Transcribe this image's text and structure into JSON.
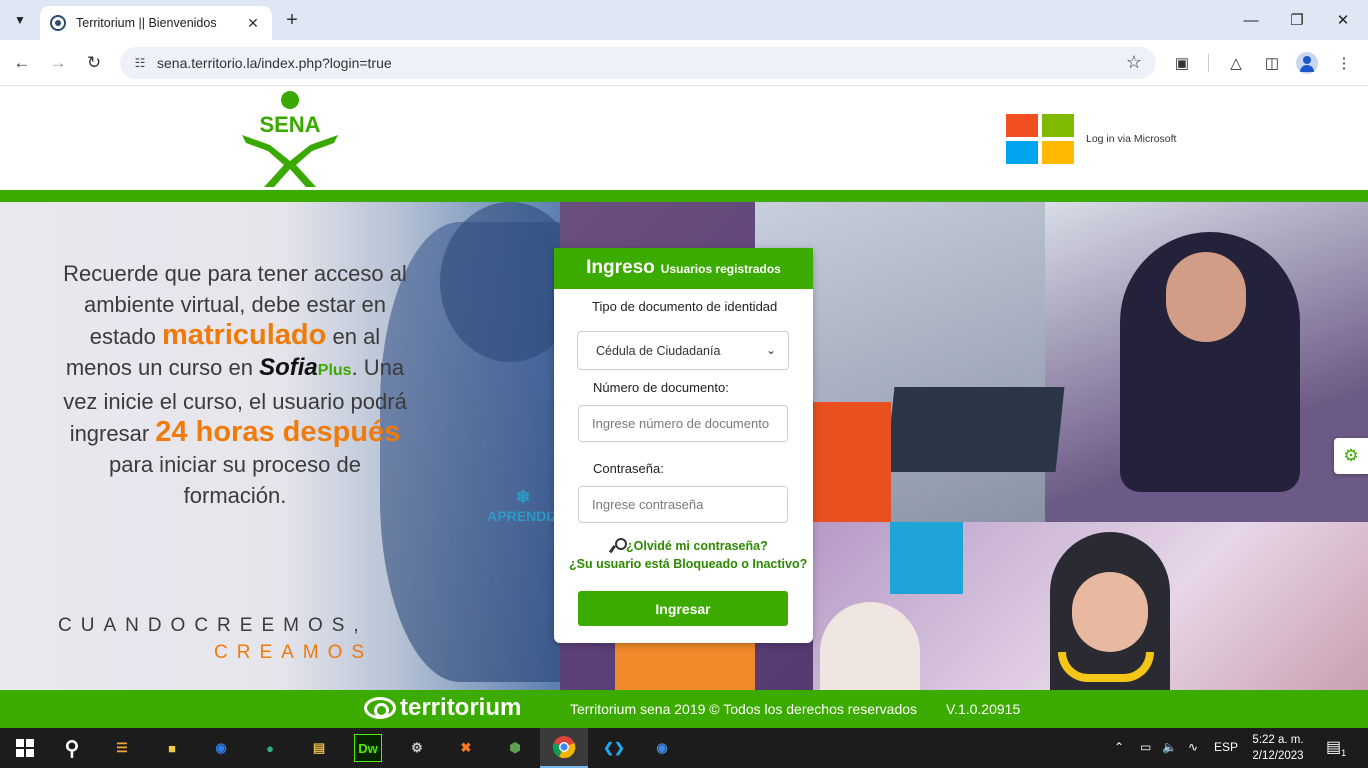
{
  "browser": {
    "tab_title": "Territorium || Bienvenidos",
    "url": "sena.territorio.la/index.php?login=true"
  },
  "header": {
    "logo_text": "SENA",
    "microsoft_login": "Log in via Microsoft",
    "ms_colors": [
      "#f25022",
      "#7fba00",
      "#00a4ef",
      "#ffb900"
    ]
  },
  "promo": {
    "line1": "Recuerde que para tener acceso al ambiente virtual, debe estar en estado",
    "highlight1": "matriculado",
    "line2": "en al menos un curso en",
    "sofia": "Sofia",
    "plus": "Plus",
    "line3": ". Una vez inicie el curso, el usuario podrá ingresar",
    "highlight2": "24 horas después",
    "line4": "para iniciar su proceso de formación.",
    "slogan_top": "CUANDOCREEMOS,",
    "slogan_bottom": "CREAMOS",
    "aprendiz": "APRENDIZ"
  },
  "login": {
    "title": "Ingreso",
    "subtitle": "Usuarios registrados",
    "doc_type_label": "Tipo de documento de identidad",
    "doc_type_value": "Cédula de Ciudadanía",
    "doc_number_label": "Número de documento:",
    "doc_number_placeholder": "Ingrese número de documento",
    "password_label": "Contraseña:",
    "password_placeholder": "Ingrese contraseña",
    "forgot": "¿Olvidé mi contraseña?",
    "blocked": "¿Su usuario está Bloqueado o Inactivo?",
    "submit": "Ingresar"
  },
  "footer": {
    "brand": "territorium",
    "copyright": "Territorium sena 2019 © Todos los derechos reservados",
    "version": "V.1.0.20915"
  },
  "taskbar": {
    "language": "ESP",
    "time": "5:22 a. m.",
    "date": "2/12/2023",
    "notifications": "1",
    "dw_label": "Dw"
  },
  "colors": {
    "brand_green": "#3cab00",
    "accent_orange": "#f07a0a"
  }
}
